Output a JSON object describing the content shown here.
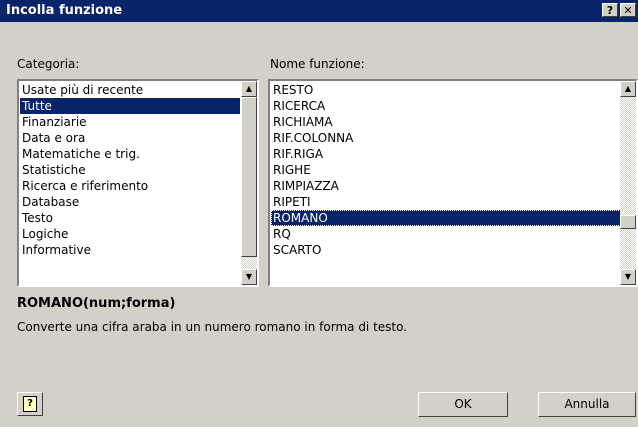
{
  "window": {
    "title": "Incolla funzione",
    "help_glyph": "?",
    "close_glyph": "✕"
  },
  "category": {
    "label": "Categoria:",
    "items": [
      "Usate più di recente",
      "Tutte",
      "Finanziarie",
      "Data e ora",
      "Matematiche e trig.",
      "Statistiche",
      "Ricerca e riferimento",
      "Database",
      "Testo",
      "Logiche",
      "Informative"
    ],
    "selected": "Tutte"
  },
  "function": {
    "label": "Nome funzione:",
    "items": [
      "RESTO",
      "RICERCA",
      "RICHIAMA",
      "RIF.COLONNA",
      "RIF.RIGA",
      "RIGHE",
      "RIMPIAZZA",
      "RIPETI",
      "ROMANO",
      "RQ",
      "SCARTO"
    ],
    "selected": "ROMANO"
  },
  "signature": "ROMANO(num;forma)",
  "description": "Converte una cifra araba in un numero romano in forma di testo.",
  "buttons": {
    "ok": "OK",
    "cancel": "Annulla",
    "help": "?"
  },
  "icons": {
    "scroll_up": "scroll-up-arrow-icon",
    "scroll_down": "scroll-down-arrow-icon",
    "help": "help-icon"
  }
}
